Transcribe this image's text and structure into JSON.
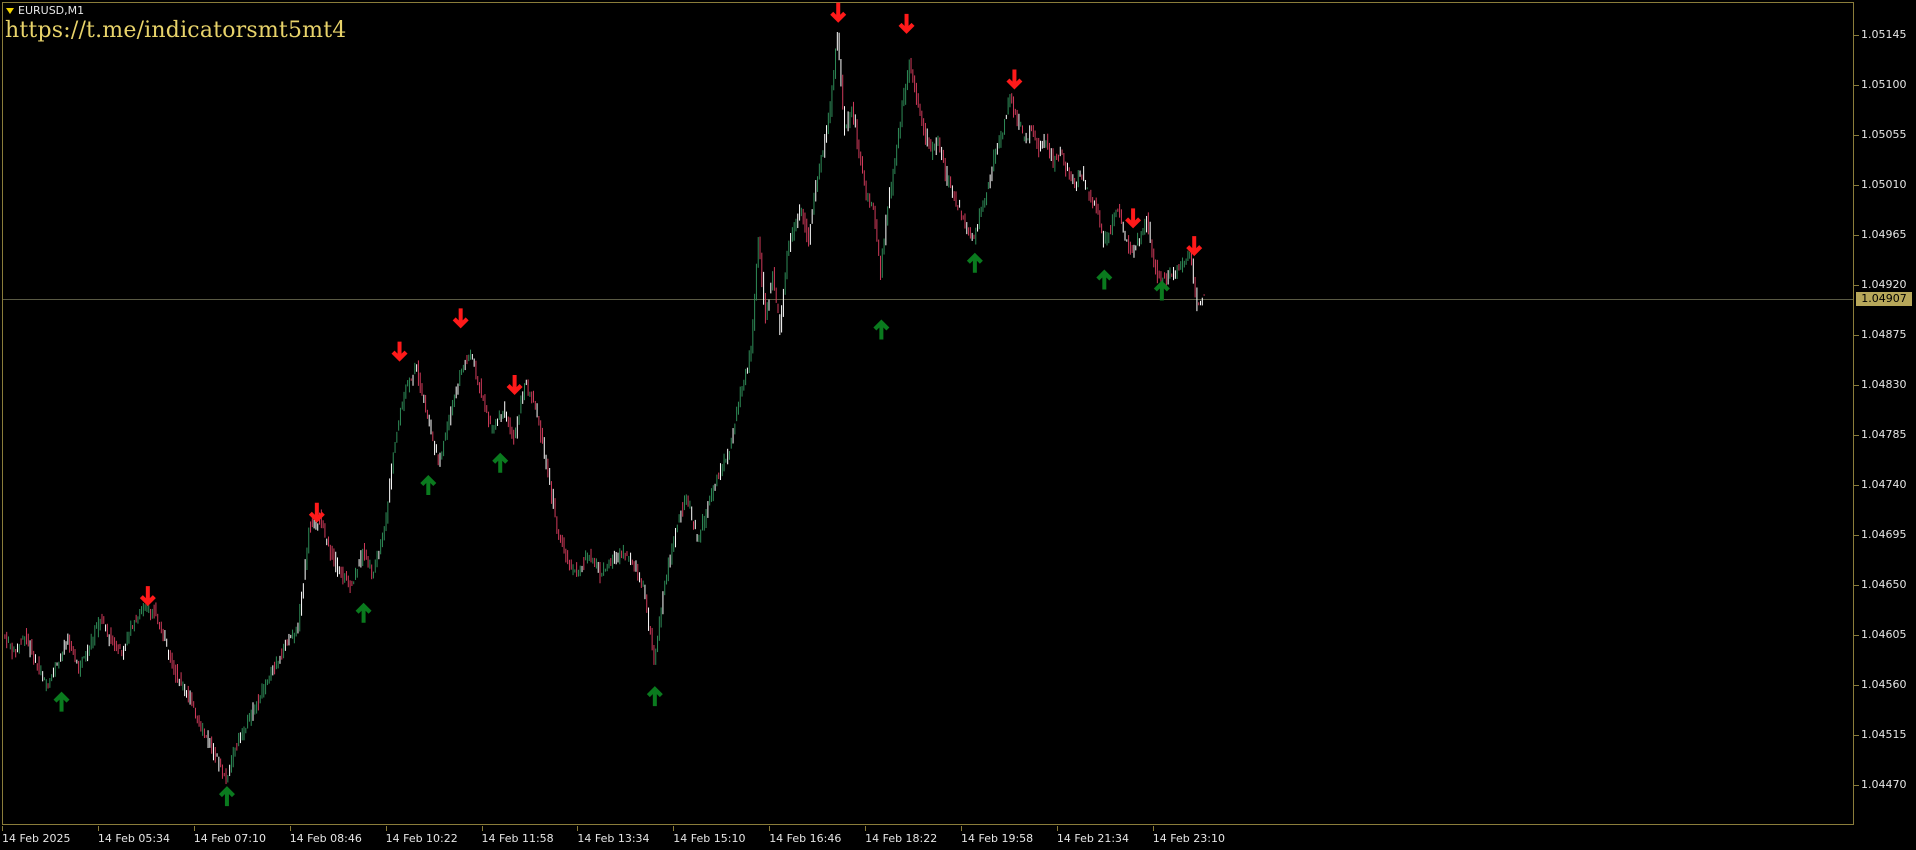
{
  "window": {
    "symbol_title": "EURUSD,M1",
    "watermark": "https://t.me/indicatorsmt5mt4"
  },
  "colors": {
    "background": "#000000",
    "frame": "#8a7c3a",
    "axis_text": "#e6e6e6",
    "bull_candle": "#2e8b57",
    "bear_candle": "#cf3a5a",
    "wick": "#ffffff",
    "up_arrow": "#0a7a1e",
    "down_arrow": "#ff1a1a",
    "current_price_line": "#5a5a44",
    "current_price_badge": "#b7a75a"
  },
  "price_axis": {
    "labels": [
      "1.05145",
      "1.05100",
      "1.05055",
      "1.05010",
      "1.04965",
      "1.04920",
      "1.04875",
      "1.04830",
      "1.04785",
      "1.04740",
      "1.04695",
      "1.04650",
      "1.04605",
      "1.04560",
      "1.04515",
      "1.04470"
    ],
    "current_price": "1.04907"
  },
  "time_axis": {
    "labels": [
      "14 Feb 2025",
      "14 Feb 05:34",
      "14 Feb 07:10",
      "14 Feb 08:46",
      "14 Feb 10:22",
      "14 Feb 11:58",
      "14 Feb 13:34",
      "14 Feb 15:10",
      "14 Feb 16:46",
      "14 Feb 18:22",
      "14 Feb 19:58",
      "14 Feb 21:34",
      "14 Feb 23:10"
    ]
  },
  "chart_data": {
    "type": "line",
    "series_kind": "candlestick-approximation",
    "ylim": [
      1.04455,
      1.0518
    ],
    "close_path": [
      [
        0,
        1.04605
      ],
      [
        3,
        1.0459
      ],
      [
        6,
        1.04605
      ],
      [
        9,
        1.0458
      ],
      [
        12,
        1.0456
      ],
      [
        15,
        1.0458
      ],
      [
        18,
        1.046
      ],
      [
        21,
        1.04575
      ],
      [
        24,
        1.04595
      ],
      [
        27,
        1.0462
      ],
      [
        30,
        1.046
      ],
      [
        33,
        1.0459
      ],
      [
        36,
        1.04615
      ],
      [
        39,
        1.0463
      ],
      [
        42,
        1.04625
      ],
      [
        45,
        1.046
      ],
      [
        48,
        1.0457
      ],
      [
        51,
        1.04555
      ],
      [
        54,
        1.0453
      ],
      [
        57,
        1.0451
      ],
      [
        60,
        1.0449
      ],
      [
        62,
        1.04475
      ],
      [
        64,
        1.045
      ],
      [
        67,
        1.0452
      ],
      [
        70,
        1.0454
      ],
      [
        73,
        1.0456
      ],
      [
        76,
        1.0458
      ],
      [
        79,
        1.046
      ],
      [
        82,
        1.0461
      ],
      [
        85,
        1.047
      ],
      [
        88,
        1.0471
      ],
      [
        91,
        1.0468
      ],
      [
        94,
        1.0466
      ],
      [
        97,
        1.0465
      ],
      [
        100,
        1.0468
      ],
      [
        103,
        1.0466
      ],
      [
        106,
        1.047
      ],
      [
        109,
        1.0478
      ],
      [
        112,
        1.0483
      ],
      [
        115,
        1.04845
      ],
      [
        118,
        1.048
      ],
      [
        121,
        1.0476
      ],
      [
        124,
        1.048
      ],
      [
        127,
        1.0484
      ],
      [
        130,
        1.0486
      ],
      [
        133,
        1.0482
      ],
      [
        136,
        1.0479
      ],
      [
        139,
        1.0481
      ],
      [
        142,
        1.0478
      ],
      [
        145,
        1.0483
      ],
      [
        148,
        1.0481
      ],
      [
        151,
        1.0476
      ],
      [
        154,
        1.047
      ],
      [
        157,
        1.0467
      ],
      [
        160,
        1.0466
      ],
      [
        163,
        1.0468
      ],
      [
        166,
        1.0466
      ],
      [
        169,
        1.0467
      ],
      [
        172,
        1.0468
      ],
      [
        175,
        1.0467
      ],
      [
        178,
        1.0465
      ],
      [
        181,
        1.0458
      ],
      [
        184,
        1.0465
      ],
      [
        187,
        1.047
      ],
      [
        190,
        1.0473
      ],
      [
        193,
        1.0469
      ],
      [
        196,
        1.0472
      ],
      [
        199,
        1.0475
      ],
      [
        202,
        1.0477
      ],
      [
        205,
        1.0482
      ],
      [
        208,
        1.0486
      ],
      [
        210,
        1.0496
      ],
      [
        212,
        1.0489
      ],
      [
        214,
        1.0493
      ],
      [
        216,
        1.0488
      ],
      [
        218,
        1.0495
      ],
      [
        220,
        1.0497
      ],
      [
        222,
        1.0499
      ],
      [
        224,
        1.0496
      ],
      [
        226,
        1.0501
      ],
      [
        228,
        1.0504
      ],
      [
        230,
        1.0508
      ],
      [
        232,
        1.05145
      ],
      [
        234,
        1.0506
      ],
      [
        236,
        1.0508
      ],
      [
        238,
        1.0504
      ],
      [
        240,
        1.05
      ],
      [
        242,
        1.0499
      ],
      [
        244,
        1.0493
      ],
      [
        246,
        1.0499
      ],
      [
        248,
        1.0503
      ],
      [
        250,
        1.0508
      ],
      [
        252,
        1.0512
      ],
      [
        254,
        1.0509
      ],
      [
        256,
        1.0506
      ],
      [
        258,
        1.0504
      ],
      [
        260,
        1.0505
      ],
      [
        262,
        1.0502
      ],
      [
        264,
        1.05
      ],
      [
        266,
        1.0499
      ],
      [
        268,
        1.0497
      ],
      [
        270,
        1.0496
      ],
      [
        272,
        1.0499
      ],
      [
        274,
        1.0501
      ],
      [
        276,
        1.0504
      ],
      [
        278,
        1.0506
      ],
      [
        280,
        1.0509
      ],
      [
        282,
        1.0507
      ],
      [
        284,
        1.0505
      ],
      [
        286,
        1.0506
      ],
      [
        288,
        1.0504
      ],
      [
        290,
        1.0505
      ],
      [
        292,
        1.0503
      ],
      [
        294,
        1.0504
      ],
      [
        296,
        1.0502
      ],
      [
        298,
        1.0501
      ],
      [
        300,
        1.0502
      ],
      [
        302,
        1.05
      ],
      [
        304,
        1.0499
      ],
      [
        306,
        1.0496
      ],
      [
        308,
        1.0497
      ],
      [
        310,
        1.0499
      ],
      [
        312,
        1.0496
      ],
      [
        314,
        1.0495
      ],
      [
        316,
        1.0496
      ],
      [
        318,
        1.0498
      ],
      [
        320,
        1.0494
      ],
      [
        322,
        1.0492
      ],
      [
        324,
        1.0493
      ],
      [
        326,
        1.0493
      ],
      [
        328,
        1.0494
      ],
      [
        330,
        1.0495
      ],
      [
        332,
        1.049
      ],
      [
        334,
        1.0491
      ]
    ],
    "x_index_range": [
      0,
      334
    ],
    "up_arrows": [
      [
        16,
        1.04545
      ],
      [
        62,
        1.0446
      ],
      [
        100,
        1.04625
      ],
      [
        118,
        1.0474
      ],
      [
        138,
        1.0476
      ],
      [
        181,
        1.0455
      ],
      [
        244,
        1.0488
      ],
      [
        270,
        1.0494
      ],
      [
        306,
        1.04925
      ],
      [
        322,
        1.04915
      ]
    ],
    "down_arrows": [
      [
        40,
        1.0464
      ],
      [
        87,
        1.04715
      ],
      [
        110,
        1.0486
      ],
      [
        127,
        1.0489
      ],
      [
        142,
        1.0483
      ],
      [
        232,
        1.05165
      ],
      [
        251,
        1.05155
      ],
      [
        281,
        1.05105
      ],
      [
        314,
        1.0498
      ],
      [
        331,
        1.04955
      ]
    ]
  }
}
